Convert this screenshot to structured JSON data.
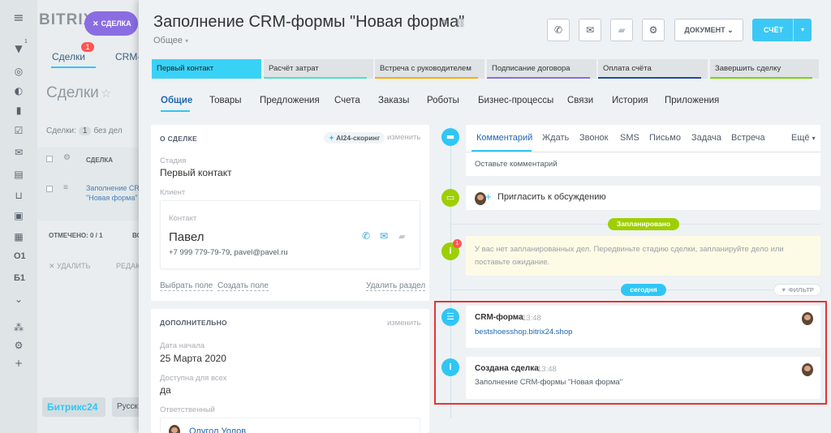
{
  "background": {
    "logo": "BITRIX",
    "deal_pill": "СДЕЛКА",
    "tab_deals": "Сделки",
    "tab_deals_badge": "1",
    "tab_crm": "CRM-",
    "title": "Сделки",
    "filter_label": "Сделки:",
    "filter_count": "1",
    "filter_suffix": "без дел",
    "col_deal": "СДЕЛКА",
    "row_deal": "Заполнение CR \"Новая форма\"",
    "selected": "ОТМЕЧЕНО: 0 / 1",
    "selected_extra": "ВС",
    "delete": "УДАЛИТЬ",
    "edit": "РЕДАК",
    "bitrix24": "Битрикс24",
    "lang": "Русск",
    "leftbar_counter": "1",
    "leftbar_text1": "О1",
    "leftbar_text2": "Б1"
  },
  "header": {
    "title": "Заполнение CRM-формы \"Новая форма\"",
    "category": "Общее",
    "document_button": "ДОКУМЕНТ",
    "invoice_button": "СЧЁТ"
  },
  "stages": [
    {
      "label": "Первый контакт",
      "color": "#39d2f7",
      "active": true
    },
    {
      "label": "Расчёт затрат",
      "color": "#47e4c2",
      "active": false
    },
    {
      "label": "Встреча с руководителем",
      "color": "#ffa900",
      "active": false
    },
    {
      "label": "Подписание договора",
      "color": "#8a6de3",
      "active": false
    },
    {
      "label": "Оплата счёта",
      "color": "#1e4ba6",
      "active": false
    },
    {
      "label": "Завершить сделку",
      "color": "#7bd500",
      "active": false
    }
  ],
  "tabs": [
    "Общие",
    "Товары",
    "Предложения",
    "Счета",
    "Заказы",
    "Роботы",
    "Бизнес-процессы",
    "Связи",
    "История",
    "Приложения"
  ],
  "about": {
    "title": "О СДЕЛКЕ",
    "scoring": "AI24-скоринг",
    "change": "изменить",
    "stage_label": "Стадия",
    "stage_value": "Первый контакт",
    "client_label": "Клиент",
    "contact_label": "Контакт",
    "contact_name": "Павел",
    "contact_details": "+7 999 779-79-79, pavel@pavel.ru",
    "select_field": "Выбрать поле",
    "create_field": "Создать поле",
    "delete_section": "Удалить раздел"
  },
  "additional": {
    "title": "ДОПОЛНИТЕЛЬНО",
    "change": "изменить",
    "start_date_label": "Дата начала",
    "start_date_value": "25 Марта 2020",
    "available_label": "Доступна для всех",
    "available_value": "да",
    "responsible_label": "Ответственный",
    "responsible_value": "Олугол Уолов"
  },
  "timeline": {
    "comment_tabs": [
      "Комментарий",
      "Ждать",
      "Звонок",
      "SMS",
      "Письмо",
      "Задача",
      "Встреча"
    ],
    "more": "Ещё",
    "comment_placeholder": "Оставьте комментарий",
    "invite": "Пригласить к обсуждению",
    "planned": "Запланировано",
    "notice_badge": "1",
    "notice": "У вас нет запланированных дел. Передвиньте стадию сделки, запланируйте дело или поставьте ожидание.",
    "today": "сегодня",
    "filter": "ФИЛЬТР",
    "events": [
      {
        "title": "CRM-форма",
        "time": "13:48",
        "text": "bestshoesshop.bitrix24.shop"
      },
      {
        "title": "Создана сделка",
        "time": "13:48",
        "text": "Заполнение CRM-формы \"Новая форма\""
      }
    ]
  },
  "colors": {
    "accent": "#2fc6f6",
    "invoice": "#3bc8f5",
    "planned": "#9dcf00",
    "timeline_blue": "#2fc6f6",
    "highlight": "#e53535"
  }
}
